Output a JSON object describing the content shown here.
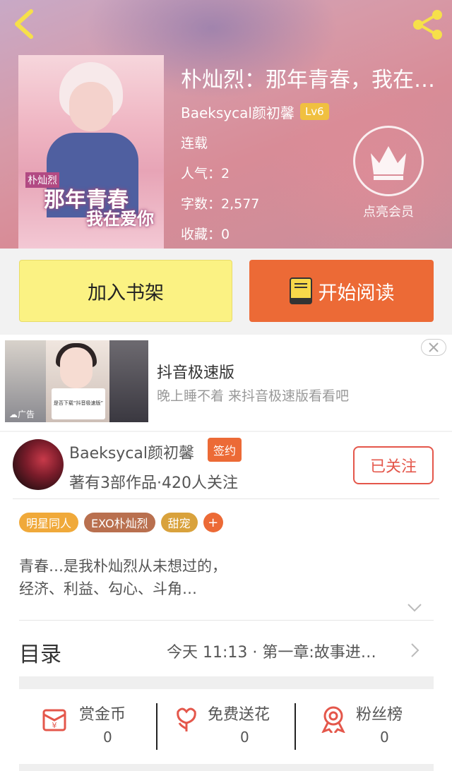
{
  "header": {
    "book_title": "朴灿烈：那年青春，我在…",
    "author": "Baeksycal颜初馨",
    "level": "Lv6",
    "status": "连载",
    "popularity": "人气：2",
    "word_count": "字数：2,577",
    "favorites": "收藏：0",
    "vip_label": "点亮会员"
  },
  "cover": {
    "line1": "那年青春",
    "line2": "我在爱你",
    "badge": "朴灿烈"
  },
  "actions": {
    "add_shelf": "加入书架",
    "start_reading": "开始阅读"
  },
  "ad": {
    "title": "抖音极速版",
    "description": "晚上睡不着 来抖音极速版看看吧",
    "tag": "广告",
    "popup_text": "是否下载“抖音极速版”"
  },
  "author_card": {
    "name": "Baeksycal颜初馨",
    "signed_badge": "签约",
    "summary": "著有3部作品·420人关注",
    "follow_label": "已关注"
  },
  "tags": [
    {
      "label": "明星同人",
      "color": "#f0a93a"
    },
    {
      "label": "EXO朴灿烈",
      "color": "#b9704f"
    },
    {
      "label": "甜宠",
      "color": "#d9a23c"
    }
  ],
  "synopsis": {
    "line1": "青春…是我朴灿烈从未想过的，",
    "line2": "经济、利益、勾心、斗角…"
  },
  "catalog": {
    "label": "目录",
    "latest": "今天 11:13 · 第一章:故事进…"
  },
  "stats": [
    {
      "label": "赏金币",
      "value": "0",
      "icon": "red-envelope-icon"
    },
    {
      "label": "免费送花",
      "value": "0",
      "icon": "flower-icon"
    },
    {
      "label": "粉丝榜",
      "value": "0",
      "icon": "medal-icon"
    }
  ],
  "colors": {
    "accent": "#ec6a36",
    "shelf_button": "#fbf283",
    "follow": "#e4574b"
  }
}
